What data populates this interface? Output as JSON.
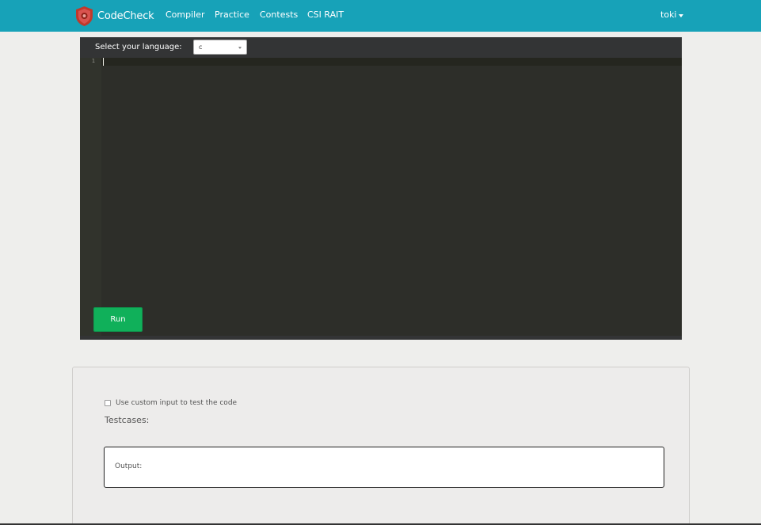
{
  "navbar": {
    "brand": "CodeCheck",
    "links": [
      "Compiler",
      "Practice",
      "Contests",
      "CSI RAIT"
    ],
    "user": "toki",
    "color": "#17a2b8"
  },
  "editor": {
    "language_label": "Select your language:",
    "language_value": "c",
    "line_numbers": [
      "1"
    ],
    "run_label": "Run",
    "run_color": "#10b05a"
  },
  "io": {
    "custom_input_label": "Use custom input to test the code",
    "custom_input_checked": false,
    "testcases_heading": "Testcases:",
    "output_label": "Output:"
  }
}
